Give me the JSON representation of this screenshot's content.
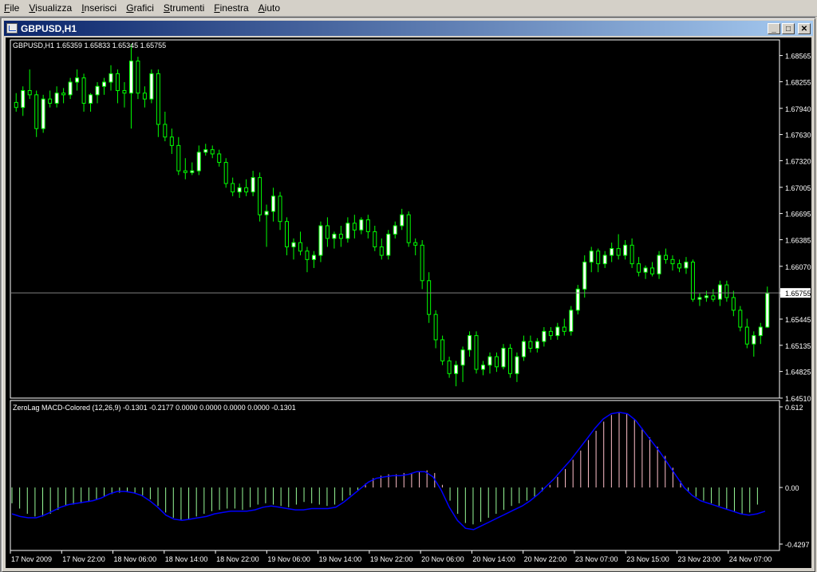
{
  "menu": [
    "File",
    "Visualizza",
    "Inserisci",
    "Grafici",
    "Strumenti",
    "Finestra",
    "Aiuto"
  ],
  "window": {
    "title": "GBPUSD,H1",
    "buttons": [
      "_",
      "□",
      "✕"
    ]
  },
  "colors": {
    "background": "#000000",
    "bull_candle": "#ffffff",
    "candle_outline": "#00ff00",
    "wick": "#00ff00",
    "macd_positive": "#ffc0cb",
    "macd_negative": "#98fb98",
    "signal_line": "#0000ff",
    "axis_text": "#ffffff",
    "current_price_line": "#808080"
  },
  "chart_data": [
    {
      "type": "candlestick",
      "title": "GBPUSD,H1",
      "header": "GBPUSD,H1  1.65359 1.65833 1.65345 1.65755",
      "ylim": [
        1.6451,
        1.6875
      ],
      "yticks": [
        "1.68565",
        "1.68255",
        "1.67940",
        "1.67630",
        "1.67320",
        "1.67005",
        "1.66695",
        "1.66385",
        "1.66070",
        "1.65755",
        "1.65445",
        "1.65135",
        "1.64825",
        "1.64510"
      ],
      "current_price": "1.65755",
      "candles": [
        [
          1.6801,
          1.6812,
          1.679,
          1.6795
        ],
        [
          1.6795,
          1.682,
          1.6785,
          1.6815
        ],
        [
          1.6815,
          1.684,
          1.6805,
          1.681
        ],
        [
          1.681,
          1.6815,
          1.676,
          1.677
        ],
        [
          1.677,
          1.681,
          1.6765,
          1.6805
        ],
        [
          1.6805,
          1.6815,
          1.6795,
          1.68
        ],
        [
          1.68,
          1.682,
          1.6795,
          1.6812
        ],
        [
          1.6812,
          1.6818,
          1.68,
          1.681
        ],
        [
          1.681,
          1.683,
          1.6805,
          1.6825
        ],
        [
          1.6825,
          1.684,
          1.6815,
          1.683
        ],
        [
          1.683,
          1.6835,
          1.679,
          1.68
        ],
        [
          1.68,
          1.6812,
          1.679,
          1.681
        ],
        [
          1.681,
          1.6825,
          1.68,
          1.682
        ],
        [
          1.682,
          1.683,
          1.681,
          1.6825
        ],
        [
          1.6825,
          1.6845,
          1.6815,
          1.6835
        ],
        [
          1.6835,
          1.684,
          1.68,
          1.6815
        ],
        [
          1.6815,
          1.6825,
          1.6795,
          1.6812
        ],
        [
          1.6812,
          1.687,
          1.677,
          1.685
        ],
        [
          1.685,
          1.6855,
          1.6805,
          1.6812
        ],
        [
          1.6812,
          1.682,
          1.6795,
          1.6805
        ],
        [
          1.6805,
          1.684,
          1.68,
          1.6835
        ],
        [
          1.6835,
          1.684,
          1.676,
          1.6775
        ],
        [
          1.6775,
          1.679,
          1.6755,
          1.676
        ],
        [
          1.676,
          1.677,
          1.674,
          1.675
        ],
        [
          1.675,
          1.676,
          1.6715,
          1.672
        ],
        [
          1.672,
          1.6735,
          1.671,
          1.6718
        ],
        [
          1.6718,
          1.673,
          1.6715,
          1.672
        ],
        [
          1.672,
          1.675,
          1.6715,
          1.6742
        ],
        [
          1.6742,
          1.6752,
          1.6738,
          1.6745
        ],
        [
          1.6745,
          1.675,
          1.6735,
          1.674
        ],
        [
          1.674,
          1.6745,
          1.6725,
          1.673
        ],
        [
          1.673,
          1.6735,
          1.67,
          1.6705
        ],
        [
          1.6705,
          1.6712,
          1.669,
          1.6695
        ],
        [
          1.6695,
          1.6705,
          1.6688,
          1.67
        ],
        [
          1.67,
          1.671,
          1.669,
          1.6695
        ],
        [
          1.6695,
          1.672,
          1.669,
          1.6712
        ],
        [
          1.6712,
          1.6718,
          1.666,
          1.6668
        ],
        [
          1.6668,
          1.668,
          1.663,
          1.6672
        ],
        [
          1.6672,
          1.67,
          1.666,
          1.669
        ],
        [
          1.669,
          1.6695,
          1.665,
          1.666
        ],
        [
          1.666,
          1.6665,
          1.662,
          1.663
        ],
        [
          1.663,
          1.664,
          1.6615,
          1.6635
        ],
        [
          1.6635,
          1.6648,
          1.662,
          1.6625
        ],
        [
          1.6625,
          1.663,
          1.66,
          1.6615
        ],
        [
          1.6615,
          1.6625,
          1.6605,
          1.662
        ],
        [
          1.662,
          1.666,
          1.6612,
          1.6655
        ],
        [
          1.6655,
          1.6665,
          1.663,
          1.664
        ],
        [
          1.664,
          1.6648,
          1.6628,
          1.6645
        ],
        [
          1.6645,
          1.6655,
          1.663,
          1.664
        ],
        [
          1.664,
          1.6665,
          1.6635,
          1.6658
        ],
        [
          1.6658,
          1.6668,
          1.664,
          1.665
        ],
        [
          1.665,
          1.6665,
          1.6645,
          1.6662
        ],
        [
          1.6662,
          1.6668,
          1.664,
          1.6648
        ],
        [
          1.6648,
          1.6655,
          1.6625,
          1.663
        ],
        [
          1.663,
          1.664,
          1.6615,
          1.662
        ],
        [
          1.662,
          1.665,
          1.6615,
          1.6645
        ],
        [
          1.6645,
          1.666,
          1.664,
          1.6655
        ],
        [
          1.6655,
          1.6675,
          1.665,
          1.6668
        ],
        [
          1.6668,
          1.6672,
          1.663,
          1.6635
        ],
        [
          1.6635,
          1.664,
          1.662,
          1.6632
        ],
        [
          1.6632,
          1.6638,
          1.658,
          1.659
        ],
        [
          1.659,
          1.66,
          1.654,
          1.655
        ],
        [
          1.655,
          1.6555,
          1.651,
          1.652
        ],
        [
          1.652,
          1.6525,
          1.649,
          1.6495
        ],
        [
          1.6495,
          1.65,
          1.6475,
          1.648
        ],
        [
          1.648,
          1.6495,
          1.6465,
          1.649
        ],
        [
          1.649,
          1.6512,
          1.647,
          1.6508
        ],
        [
          1.6508,
          1.653,
          1.65,
          1.6525
        ],
        [
          1.6525,
          1.653,
          1.648,
          1.6485
        ],
        [
          1.6485,
          1.6495,
          1.6478,
          1.649
        ],
        [
          1.649,
          1.6505,
          1.648,
          1.65
        ],
        [
          1.65,
          1.6505,
          1.6482,
          1.6488
        ],
        [
          1.6488,
          1.6515,
          1.6485,
          1.651
        ],
        [
          1.651,
          1.6515,
          1.6475,
          1.648
        ],
        [
          1.648,
          1.6505,
          1.647,
          1.65
        ],
        [
          1.65,
          1.6525,
          1.6495,
          1.6518
        ],
        [
          1.6518,
          1.6525,
          1.6505,
          1.651
        ],
        [
          1.651,
          1.6522,
          1.6505,
          1.6518
        ],
        [
          1.6518,
          1.6535,
          1.6512,
          1.653
        ],
        [
          1.653,
          1.6535,
          1.652,
          1.6525
        ],
        [
          1.6525,
          1.654,
          1.652,
          1.6535
        ],
        [
          1.6535,
          1.6545,
          1.6525,
          1.653
        ],
        [
          1.653,
          1.656,
          1.6525,
          1.6555
        ],
        [
          1.6555,
          1.6585,
          1.655,
          1.658
        ],
        [
          1.658,
          1.662,
          1.657,
          1.6612
        ],
        [
          1.6612,
          1.663,
          1.66,
          1.6625
        ],
        [
          1.6625,
          1.6628,
          1.66,
          1.661
        ],
        [
          1.661,
          1.6625,
          1.6605,
          1.662
        ],
        [
          1.662,
          1.6635,
          1.6612,
          1.6628
        ],
        [
          1.6628,
          1.6645,
          1.6615,
          1.662
        ],
        [
          1.662,
          1.6638,
          1.6615,
          1.6632
        ],
        [
          1.6632,
          1.664,
          1.6605,
          1.661
        ],
        [
          1.661,
          1.6618,
          1.6595,
          1.66
        ],
        [
          1.66,
          1.6608,
          1.6592,
          1.6605
        ],
        [
          1.6605,
          1.6612,
          1.6595,
          1.6598
        ],
        [
          1.6598,
          1.6625,
          1.6592,
          1.662
        ],
        [
          1.662,
          1.6628,
          1.661,
          1.6615
        ],
        [
          1.6615,
          1.662,
          1.6602,
          1.661
        ],
        [
          1.661,
          1.6615,
          1.66,
          1.6605
        ],
        [
          1.6605,
          1.6618,
          1.6598,
          1.6612
        ],
        [
          1.6612,
          1.6615,
          1.6565,
          1.6568
        ],
        [
          1.6568,
          1.6575,
          1.656,
          1.657
        ],
        [
          1.657,
          1.6578,
          1.6565,
          1.6572
        ],
        [
          1.6572,
          1.658,
          1.6565,
          1.6568
        ],
        [
          1.6568,
          1.659,
          1.656,
          1.6585
        ],
        [
          1.6585,
          1.659,
          1.6565,
          1.657
        ],
        [
          1.657,
          1.6578,
          1.6548,
          1.6555
        ],
        [
          1.6555,
          1.656,
          1.653,
          1.6535
        ],
        [
          1.6535,
          1.6545,
          1.651,
          1.6515
        ],
        [
          1.6515,
          1.653,
          1.65,
          1.6525
        ],
        [
          1.6525,
          1.654,
          1.6515,
          1.6535
        ],
        [
          1.6535,
          1.6583,
          1.6534,
          1.6575
        ]
      ]
    },
    {
      "type": "bar",
      "title": "ZeroLag MACD-Colored (12,26,9) -0.1301 -0.2177 0.0000 0.0000 0.0000 0.0000 -0.1301",
      "ylim": [
        -0.4297,
        0.612
      ],
      "yticks": [
        "0.612",
        "0.00",
        "-0.4297"
      ],
      "values": [
        -0.12,
        -0.16,
        -0.2,
        -0.22,
        -0.22,
        -0.2,
        -0.17,
        -0.14,
        -0.13,
        -0.12,
        -0.11,
        -0.09,
        -0.07,
        -0.05,
        -0.04,
        -0.03,
        -0.04,
        -0.06,
        -0.09,
        -0.14,
        -0.19,
        -0.23,
        -0.25,
        -0.24,
        -0.22,
        -0.2,
        -0.18,
        -0.17,
        -0.16,
        -0.16,
        -0.17,
        -0.15,
        -0.13,
        -0.12,
        -0.13,
        -0.14,
        -0.15,
        -0.13,
        -0.11,
        -0.12,
        -0.13,
        -0.14,
        -0.13,
        -0.1,
        -0.06,
        -0.02,
        0.03,
        0.07,
        0.09,
        0.1,
        0.1,
        0.11,
        0.11,
        0.12,
        0.13,
        0.11,
        0.02,
        -0.1,
        -0.2,
        -0.27,
        -0.28,
        -0.26,
        -0.23,
        -0.2,
        -0.17,
        -0.14,
        -0.12,
        -0.1,
        -0.07,
        -0.03,
        0.02,
        0.08,
        0.14,
        0.21,
        0.28,
        0.36,
        0.43,
        0.5,
        0.55,
        0.57,
        0.56,
        0.52,
        0.45,
        0.38,
        0.31,
        0.24,
        0.15,
        0.05,
        -0.03,
        -0.07,
        -0.1,
        -0.12,
        -0.14,
        -0.16,
        -0.18,
        -0.2,
        -0.19,
        -0.13
      ],
      "signal": [
        -0.2,
        -0.22,
        -0.23,
        -0.23,
        -0.21,
        -0.18,
        -0.15,
        -0.13,
        -0.12,
        -0.11,
        -0.1,
        -0.08,
        -0.05,
        -0.03,
        -0.03,
        -0.04,
        -0.06,
        -0.1,
        -0.15,
        -0.21,
        -0.24,
        -0.25,
        -0.24,
        -0.23,
        -0.22,
        -0.2,
        -0.19,
        -0.18,
        -0.18,
        -0.18,
        -0.17,
        -0.15,
        -0.14,
        -0.15,
        -0.16,
        -0.17,
        -0.17,
        -0.16,
        -0.16,
        -0.16,
        -0.15,
        -0.11,
        -0.06,
        -0.01,
        0.04,
        0.07,
        0.08,
        0.09,
        0.09,
        0.1,
        0.12,
        0.12,
        0.08,
        -0.02,
        -0.15,
        -0.25,
        -0.31,
        -0.32,
        -0.29,
        -0.26,
        -0.23,
        -0.2,
        -0.17,
        -0.14,
        -0.1,
        -0.05,
        0.01,
        0.07,
        0.14,
        0.21,
        0.29,
        0.37,
        0.45,
        0.52,
        0.56,
        0.57,
        0.56,
        0.51,
        0.43,
        0.35,
        0.27,
        0.18,
        0.09,
        0.0,
        -0.06,
        -0.1,
        -0.12,
        -0.14,
        -0.16,
        -0.18,
        -0.2,
        -0.21,
        -0.2,
        -0.18
      ]
    }
  ],
  "xaxis_labels": [
    "17 Nov 2009",
    "17 Nov 22:00",
    "18 Nov 06:00",
    "18 Nov 14:00",
    "18 Nov 22:00",
    "19 Nov 06:00",
    "19 Nov 14:00",
    "19 Nov 22:00",
    "20 Nov 06:00",
    "20 Nov 14:00",
    "20 Nov 22:00",
    "23 Nov 07:00",
    "23 Nov 15:00",
    "23 Nov 23:00",
    "24 Nov 07:00"
  ]
}
